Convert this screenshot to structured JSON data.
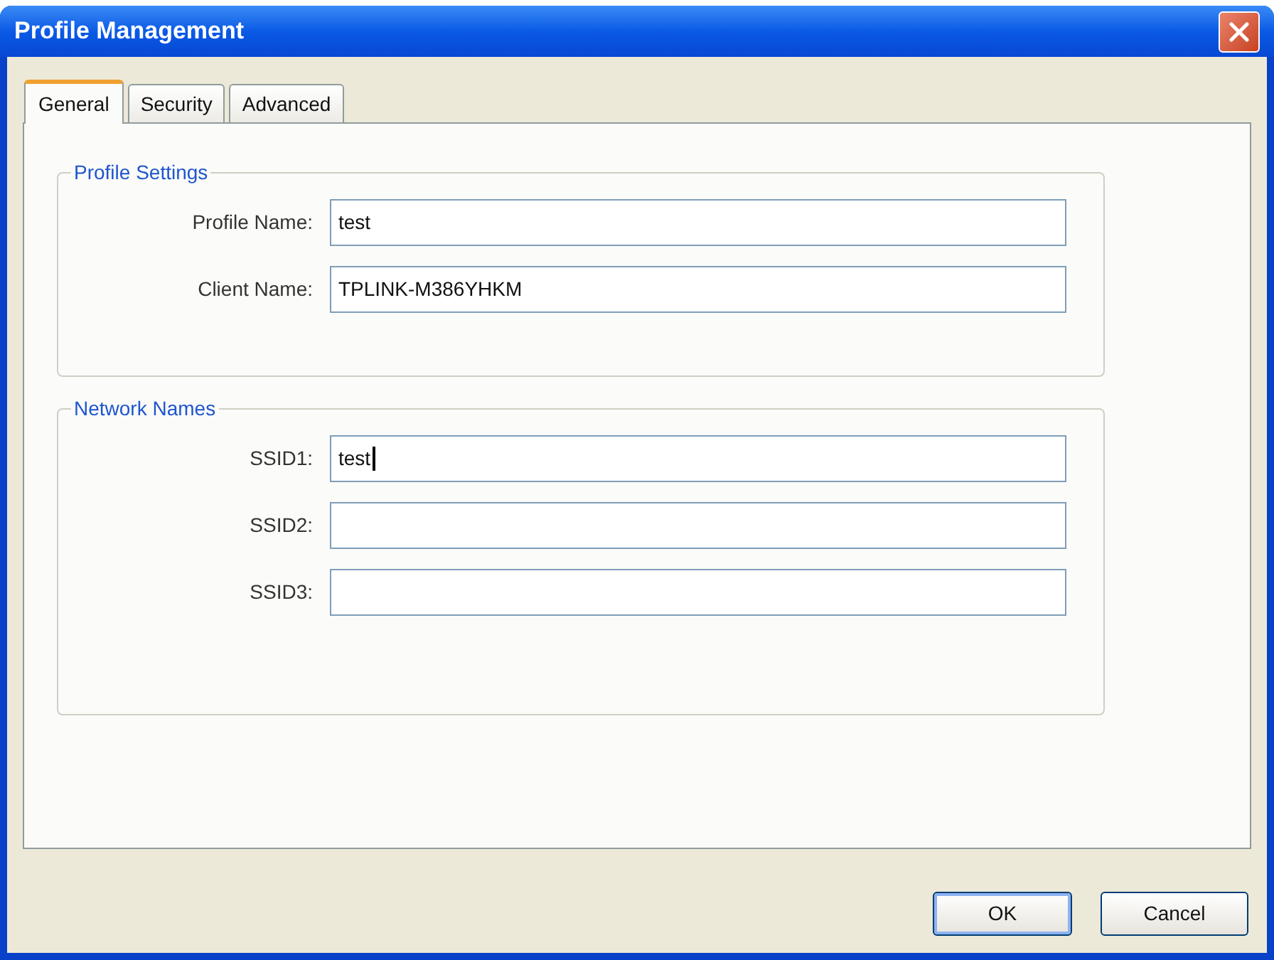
{
  "window": {
    "title": "Profile Management"
  },
  "tabs": [
    {
      "label": "General",
      "selected": true
    },
    {
      "label": "Security",
      "selected": false
    },
    {
      "label": "Advanced",
      "selected": false
    }
  ],
  "groups": [
    {
      "title": "Profile Settings",
      "fields": [
        {
          "label": "Profile Name:",
          "value": "test",
          "focused": false
        },
        {
          "label": "Client Name:",
          "value": "TPLINK-M386YHKM",
          "focused": false
        }
      ]
    },
    {
      "title": "Network Names",
      "fields": [
        {
          "label": "SSID1:",
          "value": "test",
          "focused": true
        },
        {
          "label": "SSID2:",
          "focused": false
        },
        {
          "label": "SSID3:",
          "focused": false
        }
      ]
    }
  ],
  "buttons": [
    {
      "label": "OK",
      "default": true
    },
    {
      "label": "Cancel",
      "default": false
    }
  ]
}
